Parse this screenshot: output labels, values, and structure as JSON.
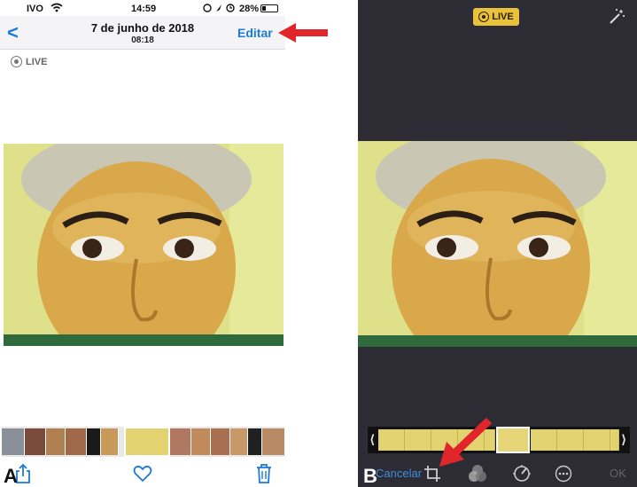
{
  "panel_a": {
    "label": "A",
    "status": {
      "carrier": "IVO",
      "time": "14:59",
      "battery": "28%"
    },
    "nav": {
      "back_glyph": "<",
      "date": "7 de junho de 2018",
      "time": "08:18",
      "edit_label": "Editar"
    },
    "live_label": "LIVE",
    "icons": {
      "back": "chevron-left-icon",
      "share": "share-icon",
      "favorite": "heart-icon",
      "delete": "trash-icon"
    }
  },
  "panel_b": {
    "label": "B",
    "live_label": "LIVE",
    "toolbar": {
      "cancel_label": "Cancelar",
      "ok_label": "OK"
    },
    "icons": {
      "auto_enhance": "magic-wand-icon",
      "crop": "crop-icon",
      "filters": "filters-icon",
      "adjust": "adjust-dial-icon",
      "more": "more-icon"
    }
  },
  "colors": {
    "ios_blue": "#1a7bd8",
    "live_yellow": "#e8c23a",
    "editor_bg": "#2d2c35",
    "annotation_red": "#e0252b"
  }
}
